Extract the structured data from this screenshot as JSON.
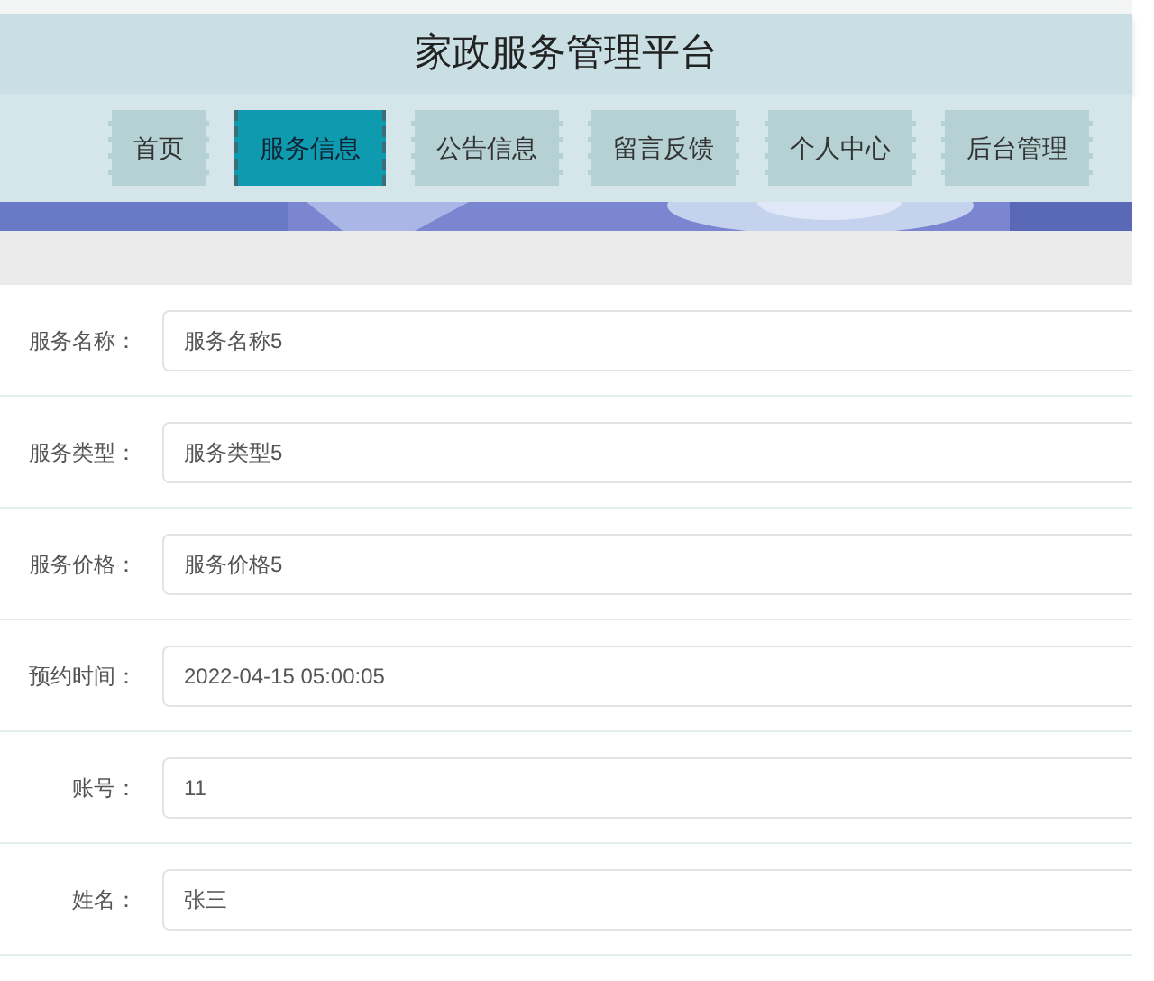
{
  "header": {
    "title": "家政服务管理平台"
  },
  "nav": [
    {
      "label": "首页",
      "selected": false
    },
    {
      "label": "服务信息",
      "selected": true
    },
    {
      "label": "公告信息",
      "selected": false
    },
    {
      "label": "留言反馈",
      "selected": false
    },
    {
      "label": "个人中心",
      "selected": false
    },
    {
      "label": "后台管理",
      "selected": false
    }
  ],
  "form": [
    {
      "label": "服务名称：",
      "value": "服务名称5"
    },
    {
      "label": "服务类型：",
      "value": "服务类型5"
    },
    {
      "label": "服务价格：",
      "value": "服务价格5"
    },
    {
      "label": "预约时间：",
      "value": "2022-04-15 05:00:05"
    },
    {
      "label": "账号：",
      "value": "11"
    },
    {
      "label": "姓名：",
      "value": "张三"
    }
  ]
}
